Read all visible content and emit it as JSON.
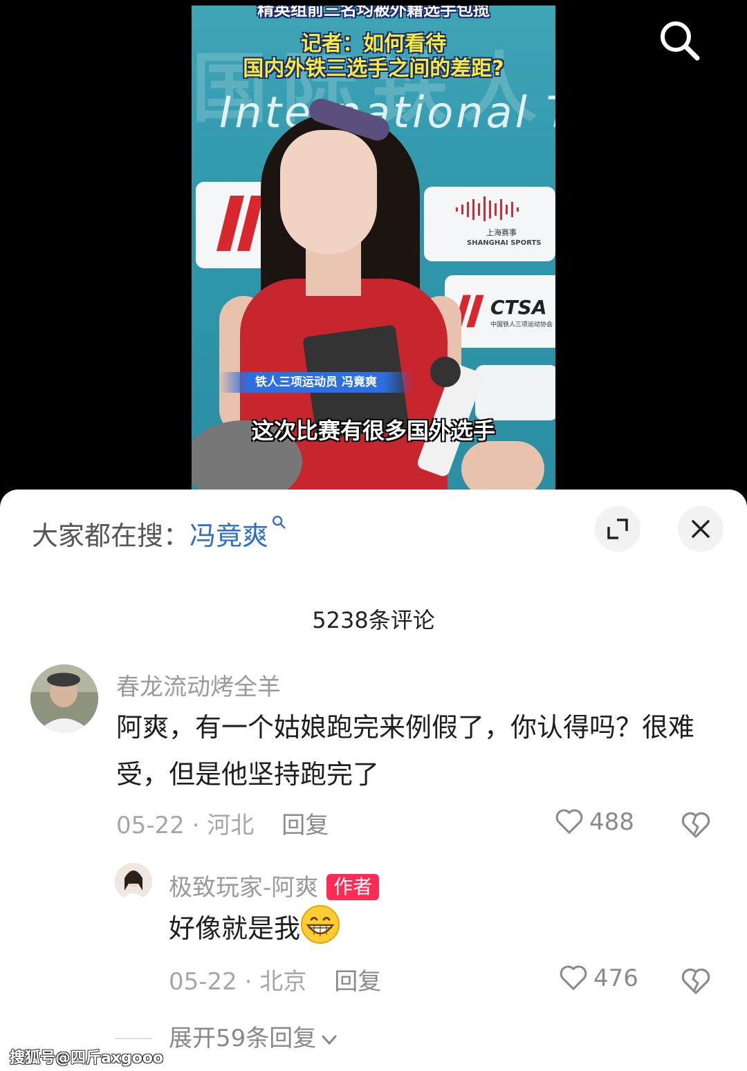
{
  "video": {
    "title_top": "精英组前三名均被外籍选手包揽",
    "title_line1": "记者：如何看待",
    "title_line2": "国内外铁三选手之间的差距?",
    "background_text": "International T",
    "background_chars": "国际铁人三",
    "name_banner": "铁人三项运动员 冯竟爽",
    "subtitle": "这次比赛有很多国外选手",
    "sponsor_shanghai_cn": "上海赛事",
    "sponsor_shanghai_en": "SHANGHAI SPORTS",
    "sponsor_ctsa": "CTSA",
    "sponsor_ctsa_sub": "中国铁人三项运动协会"
  },
  "sheet": {
    "suggest_label": "大家都在搜：",
    "suggest_term": "冯竟爽",
    "comment_count": "5238条评论",
    "comments": [
      {
        "username": "春龙流动烤全羊",
        "text": "阿爽，有一个姑娘跑完来例假了，你认得吗？很难受，但是他坚持跑完了",
        "date": "05-22 · 河北",
        "reply": "回复",
        "likes": "488"
      },
      {
        "username": "极致玩家-阿爽",
        "badge": "作者",
        "text": "好像就是我",
        "emoji": "grinning-face",
        "date": "05-22 · 北京",
        "reply": "回复",
        "likes": "476"
      }
    ],
    "expand_replies": "展开59条回复"
  },
  "watermark": "搜狐号@四斤axgooo",
  "colors": {
    "accent_blue": "#2e6ec6",
    "author_badge": "#fe2c55",
    "subtitle_yellow": "#f6ea3a"
  }
}
